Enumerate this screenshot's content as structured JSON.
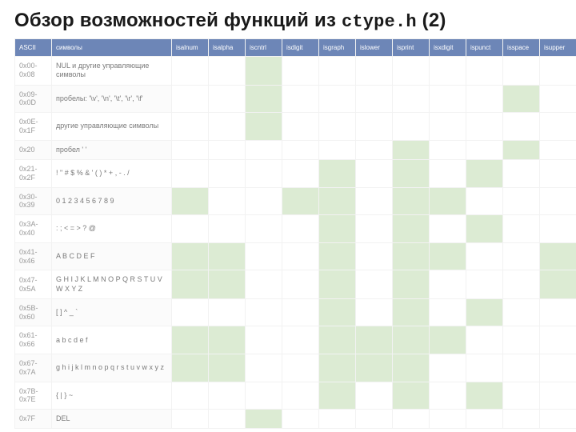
{
  "title_prefix": "Обзор возможностей функций из ",
  "title_code": "ctype.h",
  "title_suffix": " (2)",
  "columns": [
    {
      "key": "ascii",
      "label": "ASCII"
    },
    {
      "key": "chars",
      "label": "символы"
    },
    {
      "key": "isalnum",
      "label": "isalnum"
    },
    {
      "key": "isalpha",
      "label": "isalpha"
    },
    {
      "key": "iscntrl",
      "label": "iscntrl"
    },
    {
      "key": "isdigit",
      "label": "isdigit"
    },
    {
      "key": "isgraph",
      "label": "isgraph"
    },
    {
      "key": "islower",
      "label": "islower"
    },
    {
      "key": "isprint",
      "label": "isprint"
    },
    {
      "key": "isxdigit",
      "label": "isxdigit"
    },
    {
      "key": "ispunct",
      "label": "ispunct"
    },
    {
      "key": "isspace",
      "label": "isspace"
    },
    {
      "key": "isupper",
      "label": "isupper"
    }
  ],
  "rows": [
    {
      "ascii": "0x00-0x08",
      "chars": "NUL и другие управляющие символы",
      "flags": {
        "isalnum": 0,
        "isalpha": 0,
        "iscntrl": 1,
        "isdigit": 0,
        "isgraph": 0,
        "islower": 0,
        "isprint": 0,
        "isxdigit": 0,
        "ispunct": 0,
        "isspace": 0,
        "isupper": 0
      }
    },
    {
      "ascii": "0x09-0x0D",
      "chars": "пробелы: '\\v', '\\n', '\\t', '\\r', '\\f'",
      "flags": {
        "isalnum": 0,
        "isalpha": 0,
        "iscntrl": 1,
        "isdigit": 0,
        "isgraph": 0,
        "islower": 0,
        "isprint": 0,
        "isxdigit": 0,
        "ispunct": 0,
        "isspace": 1,
        "isupper": 0
      }
    },
    {
      "ascii": "0x0E-0x1F",
      "chars": "другие управляющие символы",
      "flags": {
        "isalnum": 0,
        "isalpha": 0,
        "iscntrl": 1,
        "isdigit": 0,
        "isgraph": 0,
        "islower": 0,
        "isprint": 0,
        "isxdigit": 0,
        "ispunct": 0,
        "isspace": 0,
        "isupper": 0
      }
    },
    {
      "ascii": "0x20",
      "chars": "пробел ' '",
      "flags": {
        "isalnum": 0,
        "isalpha": 0,
        "iscntrl": 0,
        "isdigit": 0,
        "isgraph": 0,
        "islower": 0,
        "isprint": 1,
        "isxdigit": 0,
        "ispunct": 0,
        "isspace": 1,
        "isupper": 0
      }
    },
    {
      "ascii": "0x21-0x2F",
      "chars": "! \" # $ % & ' ( ) * + , - . /",
      "flags": {
        "isalnum": 0,
        "isalpha": 0,
        "iscntrl": 0,
        "isdigit": 0,
        "isgraph": 1,
        "islower": 0,
        "isprint": 1,
        "isxdigit": 0,
        "ispunct": 1,
        "isspace": 0,
        "isupper": 0
      }
    },
    {
      "ascii": "0x30-0x39",
      "chars": "0 1 2 3 4 5 6 7 8 9",
      "flags": {
        "isalnum": 1,
        "isalpha": 0,
        "iscntrl": 0,
        "isdigit": 1,
        "isgraph": 1,
        "islower": 0,
        "isprint": 1,
        "isxdigit": 1,
        "ispunct": 0,
        "isspace": 0,
        "isupper": 0
      }
    },
    {
      "ascii": "0x3A-0x40",
      "chars": ": ; < = > ? @",
      "flags": {
        "isalnum": 0,
        "isalpha": 0,
        "iscntrl": 0,
        "isdigit": 0,
        "isgraph": 1,
        "islower": 0,
        "isprint": 1,
        "isxdigit": 0,
        "ispunct": 1,
        "isspace": 0,
        "isupper": 0
      }
    },
    {
      "ascii": "0x41-0x46",
      "chars": "A B C D E F",
      "flags": {
        "isalnum": 1,
        "isalpha": 1,
        "iscntrl": 0,
        "isdigit": 0,
        "isgraph": 1,
        "islower": 0,
        "isprint": 1,
        "isxdigit": 1,
        "ispunct": 0,
        "isspace": 0,
        "isupper": 1
      }
    },
    {
      "ascii": "0x47-0x5A",
      "chars": "G H I J K L M N O P Q R S T U V W X Y Z",
      "flags": {
        "isalnum": 1,
        "isalpha": 1,
        "iscntrl": 0,
        "isdigit": 0,
        "isgraph": 1,
        "islower": 0,
        "isprint": 1,
        "isxdigit": 0,
        "ispunct": 0,
        "isspace": 0,
        "isupper": 1
      }
    },
    {
      "ascii": "0x5B-0x60",
      "chars": "[ ] ^ _ `",
      "flags": {
        "isalnum": 0,
        "isalpha": 0,
        "iscntrl": 0,
        "isdigit": 0,
        "isgraph": 1,
        "islower": 0,
        "isprint": 1,
        "isxdigit": 0,
        "ispunct": 1,
        "isspace": 0,
        "isupper": 0
      }
    },
    {
      "ascii": "0x61-0x66",
      "chars": "a b c d e f",
      "flags": {
        "isalnum": 1,
        "isalpha": 1,
        "iscntrl": 0,
        "isdigit": 0,
        "isgraph": 1,
        "islower": 1,
        "isprint": 1,
        "isxdigit": 1,
        "ispunct": 0,
        "isspace": 0,
        "isupper": 0
      }
    },
    {
      "ascii": "0x67-0x7A",
      "chars": "g h i j k l m n o p q r s t u v w x y z",
      "flags": {
        "isalnum": 1,
        "isalpha": 1,
        "iscntrl": 0,
        "isdigit": 0,
        "isgraph": 1,
        "islower": 1,
        "isprint": 1,
        "isxdigit": 0,
        "ispunct": 0,
        "isspace": 0,
        "isupper": 0
      }
    },
    {
      "ascii": "0x7B-0x7E",
      "chars": "{ | } ~",
      "flags": {
        "isalnum": 0,
        "isalpha": 0,
        "iscntrl": 0,
        "isdigit": 0,
        "isgraph": 1,
        "islower": 0,
        "isprint": 1,
        "isxdigit": 0,
        "ispunct": 1,
        "isspace": 0,
        "isupper": 0
      }
    },
    {
      "ascii": "0x7F",
      "chars": "DEL",
      "flags": {
        "isalnum": 0,
        "isalpha": 0,
        "iscntrl": 1,
        "isdigit": 0,
        "isgraph": 0,
        "islower": 0,
        "isprint": 0,
        "isxdigit": 0,
        "ispunct": 0,
        "isspace": 0,
        "isupper": 0
      }
    }
  ],
  "chart_data": {
    "type": "table",
    "title": "Обзор возможностей функций из ctype.h (2)",
    "columns": [
      "ASCII",
      "символы",
      "isalnum",
      "isalpha",
      "iscntrl",
      "isdigit",
      "isgraph",
      "islower",
      "isprint",
      "isxdigit",
      "ispunct",
      "isspace",
      "isupper"
    ],
    "rows": [
      [
        "0x00-0x08",
        "NUL и другие управляющие символы",
        0,
        0,
        1,
        0,
        0,
        0,
        0,
        0,
        0,
        0,
        0
      ],
      [
        "0x09-0x0D",
        "пробелы: '\\v','\\n','\\t','\\r','\\f'",
        0,
        0,
        1,
        0,
        0,
        0,
        0,
        0,
        0,
        1,
        0
      ],
      [
        "0x0E-0x1F",
        "другие управляющие символы",
        0,
        0,
        1,
        0,
        0,
        0,
        0,
        0,
        0,
        0,
        0
      ],
      [
        "0x20",
        "пробел ' '",
        0,
        0,
        0,
        0,
        0,
        0,
        1,
        0,
        0,
        1,
        0
      ],
      [
        "0x21-0x2F",
        "! \" # $ % & ' ( ) * + , - . /",
        0,
        0,
        0,
        0,
        1,
        0,
        1,
        0,
        1,
        0,
        0
      ],
      [
        "0x30-0x39",
        "0 1 2 3 4 5 6 7 8 9",
        1,
        0,
        0,
        1,
        1,
        0,
        1,
        1,
        0,
        0,
        0
      ],
      [
        "0x3A-0x40",
        ": ; < = > ? @",
        0,
        0,
        0,
        0,
        1,
        0,
        1,
        0,
        1,
        0,
        0
      ],
      [
        "0x41-0x46",
        "A B C D E F",
        1,
        1,
        0,
        0,
        1,
        0,
        1,
        1,
        0,
        0,
        1
      ],
      [
        "0x47-0x5A",
        "G H I J K L M N O P Q R S T U V W X Y Z",
        1,
        1,
        0,
        0,
        1,
        0,
        1,
        0,
        0,
        0,
        1
      ],
      [
        "0x5B-0x60",
        "[ ] ^ _ `",
        0,
        0,
        0,
        0,
        1,
        0,
        1,
        0,
        1,
        0,
        0
      ],
      [
        "0x61-0x66",
        "a b c d e f",
        1,
        1,
        0,
        0,
        1,
        1,
        1,
        1,
        0,
        0,
        0
      ],
      [
        "0x67-0x7A",
        "g h i j k l m n o p q r s t u v w x y z",
        1,
        1,
        0,
        0,
        1,
        1,
        1,
        0,
        0,
        0,
        0
      ],
      [
        "0x7B-0x7E",
        "{ | } ~",
        0,
        0,
        0,
        0,
        1,
        0,
        1,
        0,
        1,
        0,
        0
      ],
      [
        "0x7F",
        "DEL",
        0,
        0,
        1,
        0,
        0,
        0,
        0,
        0,
        0,
        0,
        0
      ]
    ]
  }
}
